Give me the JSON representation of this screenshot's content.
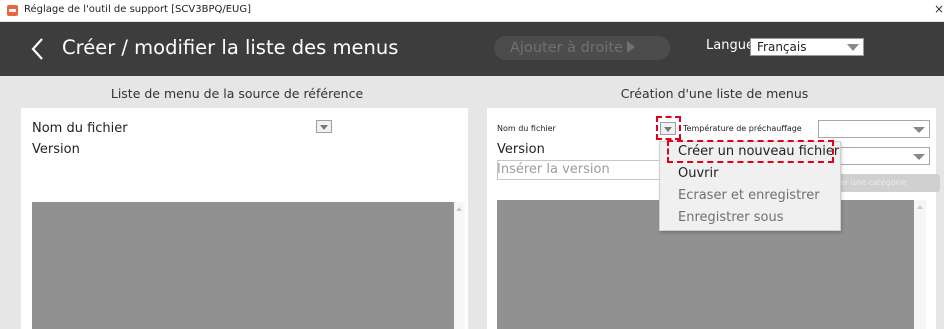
{
  "window": {
    "title": "Réglage de l'outil de support [SCV3BPQ/EUG]",
    "close_glyph": "×"
  },
  "header": {
    "title": "Créer / modifier la liste des menus",
    "add_right_label": "Ajouter à droite",
    "language_label": "Langue",
    "language_value": "Français"
  },
  "left_panel": {
    "heading": "Liste de menu de la source de référence",
    "filename_label": "Nom du fichier",
    "version_label": "Version"
  },
  "right_panel": {
    "heading": "Création d'une liste de menus",
    "filename_label": "Nom du fichier",
    "preheat_label": "Température de préchauffage",
    "version_label": "Version",
    "version_placeholder": "Insérer la version",
    "add_category_label": "er une catégorie"
  },
  "dropdown_menu": {
    "items": [
      {
        "label": "Créer un nouveau fichier",
        "enabled": true,
        "highlighted": true
      },
      {
        "label": "Ouvrir",
        "enabled": true
      },
      {
        "label": "Ecraser et enregistrer",
        "enabled": false
      },
      {
        "label": "Enregistrer sous",
        "enabled": false
      }
    ]
  },
  "colors": {
    "header_bg": "#3d3d3d",
    "content_bg": "#e6e6e6",
    "list_area": "#919191",
    "highlight_dash": "#e0001a",
    "app_icon": "#e8663c"
  },
  "icons": [
    "app-icon",
    "back-chevron-icon",
    "arrow-right-icon",
    "dropdown-arrow-icon",
    "close-icon"
  ]
}
